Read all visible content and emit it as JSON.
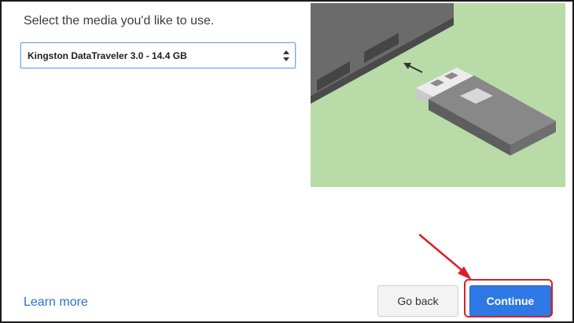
{
  "dialog": {
    "prompt": "Select the media you'd like to use.",
    "media_select": {
      "selected_value": "Kingston DataTraveler 3.0 - 14.4 GB"
    },
    "illustration": {
      "name": "usb-insert-illustration",
      "background_color": "#b9dba8"
    },
    "learn_more_label": "Learn more",
    "buttons": {
      "back_label": "Go back",
      "continue_label": "Continue"
    },
    "annotation": {
      "arrow_color": "#d8202a",
      "highlight_color": "#d8202a"
    }
  }
}
